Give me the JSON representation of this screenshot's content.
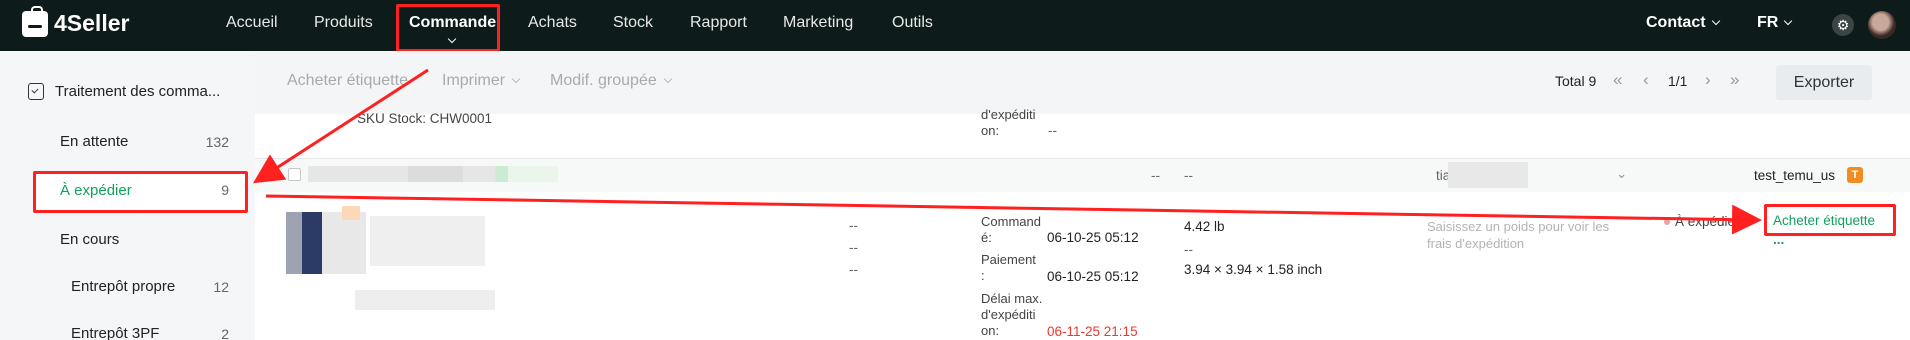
{
  "brand": {
    "name": "4Seller"
  },
  "nav": {
    "items": [
      "Accueil",
      "Produits",
      "Commande",
      "Achats",
      "Stock",
      "Rapport",
      "Marketing",
      "Outils"
    ],
    "contact": "Contact",
    "lang": "FR"
  },
  "sidebar": {
    "header": "Traitement des comma...",
    "items": [
      {
        "label": "En attente",
        "count": "132"
      },
      {
        "label": "À expédier",
        "count": "9"
      },
      {
        "label": "En cours",
        "count": ""
      },
      {
        "label": "Entrepôt propre",
        "count": "12"
      },
      {
        "label": "Entrepôt 3PF",
        "count": "2"
      }
    ]
  },
  "toolbar": {
    "buy_label": "Acheter étiquette",
    "print_label": "Imprimer",
    "bulk_edit_label": "Modif. groupée",
    "total": "Total 9",
    "page": "1/1",
    "export_label": "Exporter"
  },
  "prev_row": {
    "sku": "SKU Stock: CHW0001",
    "deadline_label_1": "d'expéditi",
    "deadline_label_2": "on:",
    "deadline_value": "--"
  },
  "order_header": {
    "dash1": "--",
    "dash2": "--",
    "account_prefix": "tia",
    "store": "test_temu_us",
    "store_badge": "T"
  },
  "order": {
    "dashes": [
      "--",
      "--",
      "--"
    ],
    "ordered_label_1": "Command",
    "ordered_label_2": "é:",
    "ordered_value": "06-10-25 05:12",
    "paid_label_1": "Paiement",
    "paid_label_2": ":",
    "paid_value": "06-10-25 05:12",
    "deadline_label_1": "Délai max.",
    "deadline_label_2": "d'expéditi",
    "deadline_label_3": "on:",
    "deadline_value": "06-11-25 21:15",
    "weight": "4.42 lb",
    "weight_dash": "--",
    "dims": "3.94 × 3.94 × 1.58 inch",
    "weight_hint_1": "Saisissez un poids pour voir les",
    "weight_hint_2": "frais d'expédition",
    "status": "À expédier",
    "action": "Acheter étiquette",
    "more": "..."
  },
  "colors": {
    "accent": "#12a05c",
    "nav_bg": "#0d1c1a",
    "highlight": "#ff2020",
    "deadline": "#e8392f",
    "store_badge": "#f28c22"
  }
}
